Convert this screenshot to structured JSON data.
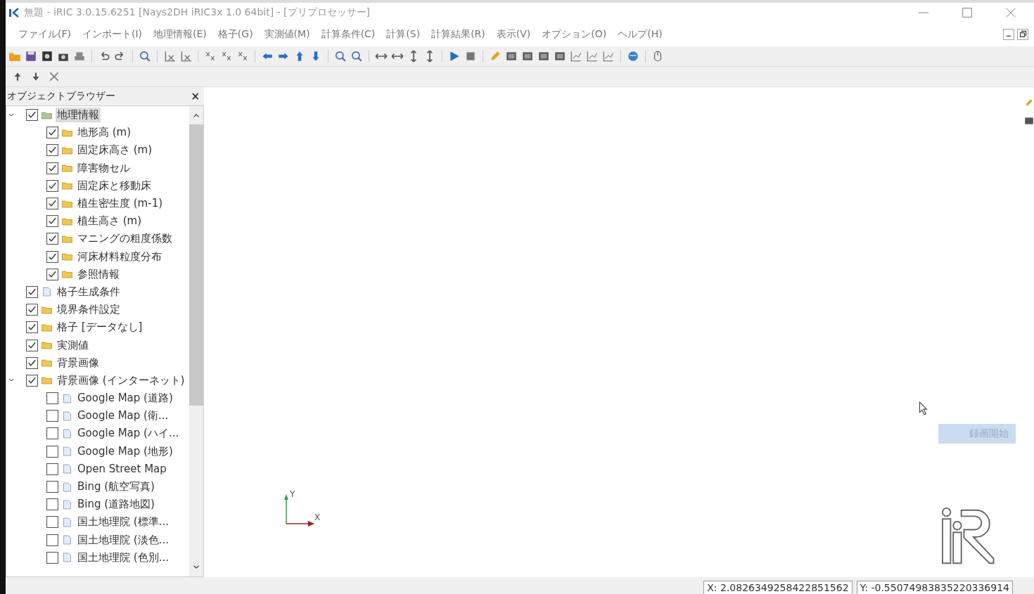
{
  "window": {
    "title": "無題 - iRIC 3.0.15.6251 [Nays2DH iRIC3x 1.0 64bit] - [プリプロセッサー]"
  },
  "menu": [
    "ファイル(F)",
    "インポート(I)",
    "地理情報(E)",
    "格子(G)",
    "実測値(M)",
    "計算条件(C)",
    "計算(S)",
    "計算結果(R)",
    "表示(V)",
    "オプション(O)",
    "ヘルプ(H)"
  ],
  "object_browser": {
    "title": "オブジェクトブラウザー",
    "close": "×",
    "tree": [
      {
        "label": "地理情報",
        "kind": "folder",
        "checked": true,
        "selected": true,
        "expanded": true,
        "children": [
          {
            "label": "地形高 (m)",
            "kind": "folder",
            "checked": true,
            "selected": false
          },
          {
            "label": "固定床高さ (m)",
            "kind": "folder",
            "checked": true,
            "selected": false
          },
          {
            "label": "障害物セル",
            "kind": "folder",
            "checked": true,
            "selected": false
          },
          {
            "label": "固定床と移動床",
            "kind": "folder",
            "checked": true,
            "selected": false
          },
          {
            "label": "植生密生度 (m-1)",
            "kind": "folder",
            "checked": true,
            "selected": false
          },
          {
            "label": "植生高さ (m)",
            "kind": "folder",
            "checked": true,
            "selected": false
          },
          {
            "label": "マニングの粗度係数",
            "kind": "folder",
            "checked": true,
            "selected": false
          },
          {
            "label": "河床材料粒度分布",
            "kind": "folder",
            "checked": true,
            "selected": false
          },
          {
            "label": "参照情報",
            "kind": "folder",
            "checked": true,
            "selected": false
          }
        ]
      },
      {
        "label": "格子生成条件",
        "kind": "file",
        "checked": true,
        "selected": false
      },
      {
        "label": "境界条件設定",
        "kind": "folder",
        "checked": true,
        "selected": false
      },
      {
        "label": "格子 [データなし]",
        "kind": "folder",
        "checked": true,
        "selected": false
      },
      {
        "label": "実測値",
        "kind": "folder",
        "checked": true,
        "selected": false
      },
      {
        "label": "背景画像",
        "kind": "folder",
        "checked": true,
        "selected": false
      },
      {
        "label": "背景画像 (インターネット)",
        "kind": "folder",
        "checked": true,
        "selected": false,
        "expanded": true,
        "children": [
          {
            "label": "Google Map (道路)",
            "kind": "file",
            "checked": false,
            "selected": false
          },
          {
            "label": "Google Map (衛...",
            "kind": "file",
            "checked": false,
            "selected": false
          },
          {
            "label": "Google Map (ハイ...",
            "kind": "file",
            "checked": false,
            "selected": false
          },
          {
            "label": "Google Map (地形)",
            "kind": "file",
            "checked": false,
            "selected": false
          },
          {
            "label": "Open Street Map",
            "kind": "file",
            "checked": false,
            "selected": false
          },
          {
            "label": "Bing (航空写真)",
            "kind": "file",
            "checked": false,
            "selected": false
          },
          {
            "label": "Bing (道路地図)",
            "kind": "file",
            "checked": false,
            "selected": false
          },
          {
            "label": "国土地理院 (標準...",
            "kind": "file",
            "checked": false,
            "selected": false
          },
          {
            "label": "国土地理院 (淡色...",
            "kind": "file",
            "checked": false,
            "selected": false
          },
          {
            "label": "国土地理院 (色別...",
            "kind": "file",
            "checked": false,
            "selected": false
          }
        ]
      }
    ]
  },
  "canvas": {
    "axis_y": "Y",
    "axis_x": "X",
    "record_button": "録画開始"
  },
  "status_bar": {
    "x": "X: 2.0826349258422851562",
    "y": "Y: -0.55074983835220336914"
  }
}
